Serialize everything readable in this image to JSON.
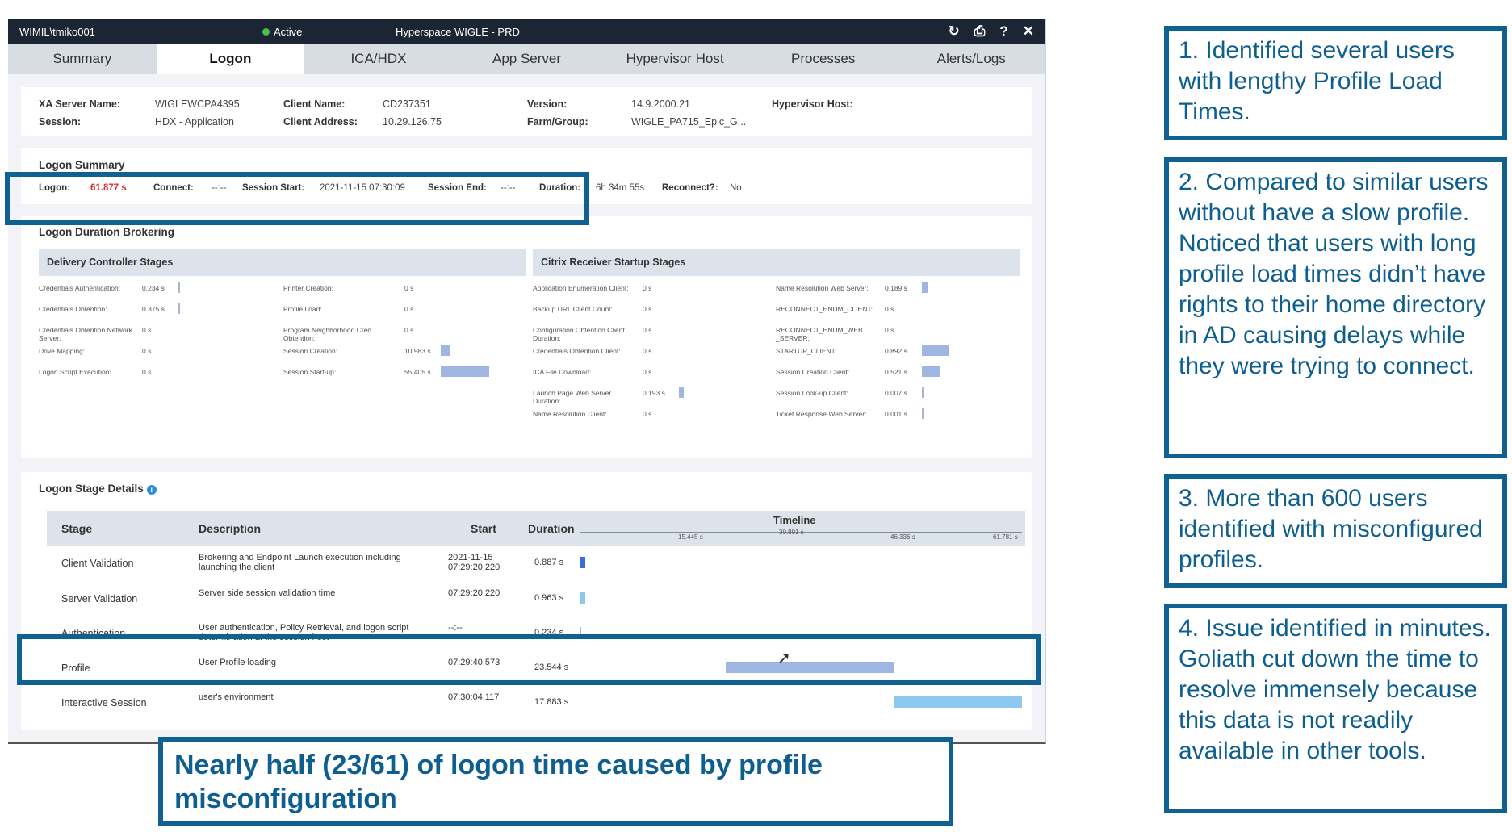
{
  "window": {
    "user": "WIMIL\\tmiko001",
    "status": "Active",
    "title": "Hyperspace WIGLE - PRD",
    "icons": [
      "refresh-icon",
      "print-icon",
      "help-icon",
      "close-icon"
    ]
  },
  "tabs": [
    "Summary",
    "Logon",
    "ICA/HDX",
    "App Server",
    "Hypervisor Host",
    "Processes",
    "Alerts/Logs"
  ],
  "active_tab": "Logon",
  "info": {
    "xa_label": "XA Server Name:",
    "xa_value": "WIGLEWCPA4395",
    "session_label": "Session:",
    "session_value": "HDX - Application",
    "client_name_label": "Client Name:",
    "client_name_value": "CD237351",
    "client_addr_label": "Client Address:",
    "client_addr_value": "10.29.126.75",
    "version_label": "Version:",
    "version_value": "14.9.2000.21",
    "farm_label": "Farm/Group:",
    "farm_value": "WIGLE_PA715_Epic_G...",
    "hyp_label": "Hypervisor Host:"
  },
  "logon_summary": {
    "title": "Logon Summary",
    "logon_label": "Logon:",
    "logon_value": "61.877 s",
    "connect_label": "Connect:",
    "connect_value": "--:--",
    "session_start_label": "Session Start:",
    "session_start_value": "2021-11-15 07:30:09",
    "session_end_label": "Session End:",
    "session_end_value": "--:--",
    "duration_label": "Duration:",
    "duration_value": "6h 34m 55s",
    "reconnect_label": "Reconnect?:",
    "reconnect_value": "No"
  },
  "brokering": {
    "title": "Logon Duration Brokering",
    "delivery_title": "Delivery Controller Stages",
    "receiver_title": "Citrix Receiver Startup Stages",
    "delivery_left": [
      {
        "name": "Credentials Authentication:",
        "value": "0.234 s",
        "level": 0.01
      },
      {
        "name": "Credentials Obtention:",
        "value": "0.375 s",
        "level": 0.01
      },
      {
        "name": "Credentials Obtention Network Server:",
        "value": "0 s",
        "level": 0
      },
      {
        "name": "Drive Mapping:",
        "value": "0 s",
        "level": 0
      },
      {
        "name": "Logon Script Execution:",
        "value": "0 s",
        "level": 0
      }
    ],
    "delivery_right": [
      {
        "name": "Printer Creation:",
        "value": "0 s",
        "level": 0
      },
      {
        "name": "Profile Load:",
        "value": "0 s",
        "level": 0
      },
      {
        "name": "Program Neighborhood Cred Obtention:",
        "value": "0 s",
        "level": 0
      },
      {
        "name": "Session Creation:",
        "value": "10.983 s",
        "level": 0.2
      },
      {
        "name": "Session Start-up:",
        "value": "55.405 s",
        "level": 1.0
      }
    ],
    "receiver_left": [
      {
        "name": "Application Enumeration Client:",
        "value": "0 s",
        "level": 0
      },
      {
        "name": "Backup URL Client Count:",
        "value": "0 s",
        "level": 0
      },
      {
        "name": "Configuration Obtention Client Duration:",
        "value": "0 s",
        "level": 0
      },
      {
        "name": "Credentials Obtention Client:",
        "value": "0 s",
        "level": 0
      },
      {
        "name": "ICA File Download:",
        "value": "0 s",
        "level": 0
      },
      {
        "name": "Launch Page Web Server Duration:",
        "value": "0.193 s",
        "level": 0.2
      },
      {
        "name": "Name Resolution Client:",
        "value": "0 s",
        "level": 0
      }
    ],
    "receiver_right": [
      {
        "name": "Name Resolution Web Server:",
        "value": "0.189 s",
        "level": 0.2
      },
      {
        "name": "RECONNECT_ENUM_CLIENT:",
        "value": "0 s",
        "level": 0
      },
      {
        "name": "RECONNECT_ENUM_WEB _SERVER:",
        "value": "0 s",
        "level": 0
      },
      {
        "name": "STARTUP_CLIENT:",
        "value": "0.892 s",
        "level": 1.0
      },
      {
        "name": "Session Creation Client:",
        "value": "0.521 s",
        "level": 0.65
      },
      {
        "name": "Session Look-up Client:",
        "value": "0.007 s",
        "level": 0.01
      },
      {
        "name": "Ticket Response Web Server:",
        "value": "0.001 s",
        "level": 0.01
      }
    ]
  },
  "stage_details": {
    "title": "Logon Stage Details",
    "headers": {
      "stage": "Stage",
      "description": "Description",
      "start": "Start",
      "duration": "Duration",
      "timeline": "Timeline"
    },
    "ticks": [
      "15.445 s",
      "30.891 s",
      "46.336 s",
      "61.781 s"
    ],
    "rows": [
      {
        "stage": "Client Validation",
        "description": "Brokering and Endpoint Launch execution including launching the client",
        "start": "2021-11-15 07:29:20.220",
        "duration": "0.887 s"
      },
      {
        "stage": "Server Validation",
        "description": "Server side session validation time",
        "start": "07:29:20.220",
        "duration": "0.963 s"
      },
      {
        "stage": "Authentication",
        "description": "User authentication, Policy Retrieval, and logon script determination at the session host",
        "start": "--:--",
        "duration": "0.234 s"
      },
      {
        "stage": "Profile",
        "description": "User Profile loading",
        "start": "07:29:40.573",
        "duration": "23.544 s"
      },
      {
        "stage": "Interactive Session",
        "description": "user's environment",
        "start": "07:30:04.117",
        "duration": "17.883 s"
      }
    ]
  },
  "callouts": [
    "1. Identified several users with lengthy Profile Load Times.",
    "2. Compared to similar users without have a slow profile. Noticed that users with long profile load times didn’t have rights to their home directory in AD causing delays while they were trying to connect.",
    "3. More than 600 users identified with misconfigured profiles.",
    "4. Issue identified in minutes. Goliath cut down the time to resolve immensely because this data is not readily available in other tools."
  ],
  "bottom_callout": "Nearly half (23/61) of logon time caused by profile misconfiguration",
  "colors": {
    "accent": "#0e6191",
    "logon_red": "#d32f2f",
    "titlebar": "#1c2533"
  }
}
